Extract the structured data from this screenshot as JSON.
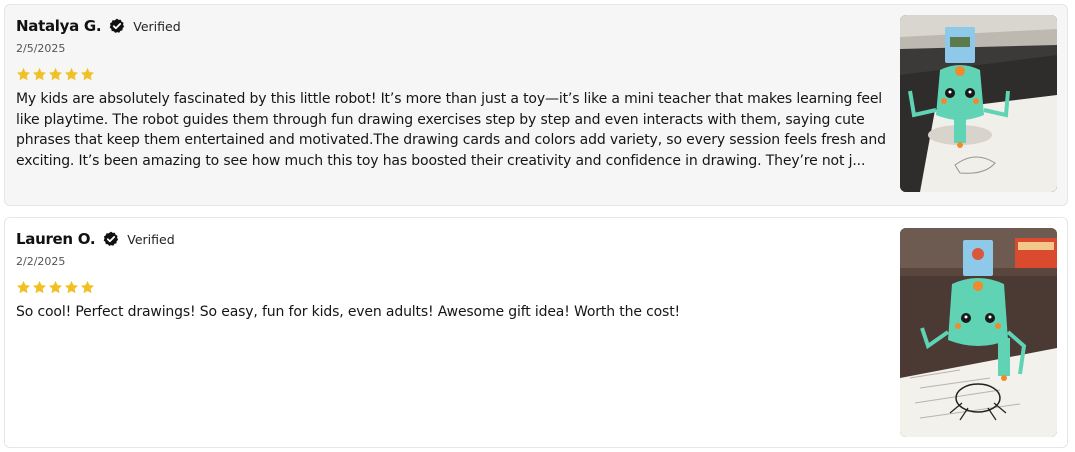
{
  "reviews": [
    {
      "name": "Natalya G.",
      "verified_label": "Verified",
      "date": "2/5/2025",
      "rating": 5,
      "text": "My kids are absolutely fascinated by this little robot! It’s more than just a toy—it’s like a mini teacher that makes learning feel like playtime. The robot guides them through fun drawing exercises step by step and even interacts with them, saying cute phrases that keep them entertained and motivated.The drawing cards and colors add variety, so every session feels fresh and exciting. It’s been amazing to see how much this toy has boosted their creativity and confidence in drawing. They’re not j..."
    },
    {
      "name": "Lauren O.",
      "verified_label": "Verified",
      "date": "2/2/2025",
      "rating": 5,
      "text": "So cool! Perfect drawings! So easy, fun for kids, even adults! Awesome gift idea! Worth the cost!"
    }
  ],
  "colors": {
    "star": "#f2c023",
    "verified_badge": "#111111",
    "robot": "#5fd3b4",
    "accent_orange": "#f08a2c"
  },
  "icons": {
    "verified": "check-badge-icon",
    "star": "star-icon"
  }
}
